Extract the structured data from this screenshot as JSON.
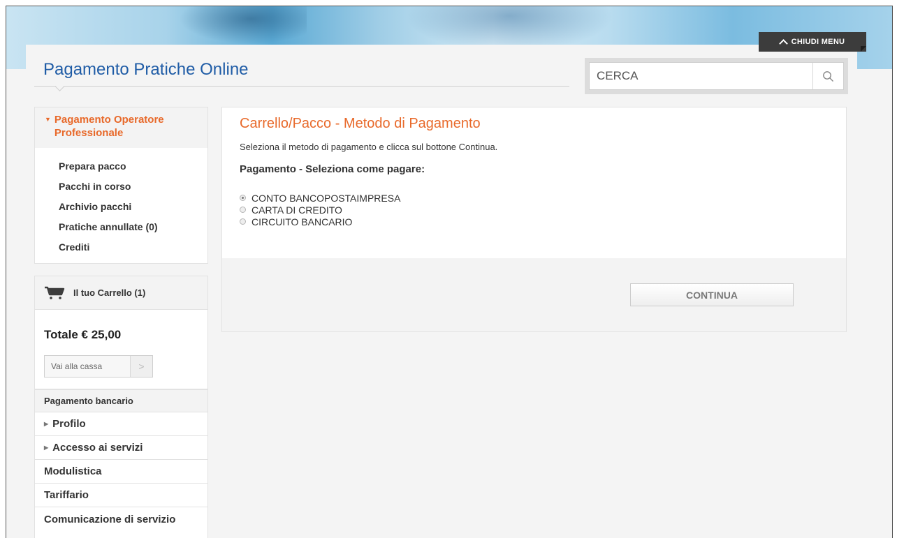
{
  "header": {
    "close_menu_label": "CHIUDI MENU",
    "page_title": "Pagamento Pratiche Online",
    "search_placeholder": "CERCA"
  },
  "sidebar": {
    "section_title": "Pagamento Operatore Professionale",
    "links": [
      {
        "label": "Prepara pacco"
      },
      {
        "label": "Pacchi in corso"
      },
      {
        "label": "Archivio pacchi"
      },
      {
        "label": "Pratiche annullate (0)"
      },
      {
        "label": "Crediti"
      }
    ],
    "cart": {
      "label": "Il tuo Carrello (1)",
      "total": "Totale € 25,00",
      "checkout_label": "Vai alla cassa",
      "checkout_arrow": ">"
    },
    "nav": [
      {
        "label": "Pagamento bancario"
      },
      {
        "label": "Profilo"
      },
      {
        "label": "Accesso ai servizi"
      },
      {
        "label": "Modulistica"
      },
      {
        "label": "Tariffario"
      },
      {
        "label": "Comunicazione di servizio"
      }
    ]
  },
  "main": {
    "heading": "Carrello/Pacco - Metodo di Pagamento",
    "description": "Seleziona il metodo di pagamento e clicca sul bottone Continua.",
    "subheading": "Pagamento - Seleziona come pagare:",
    "options": [
      {
        "label": "CONTO BANCOPOSTAIMPRESA",
        "selected": true
      },
      {
        "label": "CARTA DI CREDITO",
        "selected": false
      },
      {
        "label": "CIRCUITO BANCARIO",
        "selected": false
      }
    ],
    "continue_label": "CONTINUA"
  },
  "colors": {
    "brand_blue": "#1f5ca6",
    "accent_orange": "#e8692a"
  },
  "icons": {
    "search": "search-icon",
    "cart": "cart-icon",
    "close_menu": "chevron-up-icon"
  }
}
